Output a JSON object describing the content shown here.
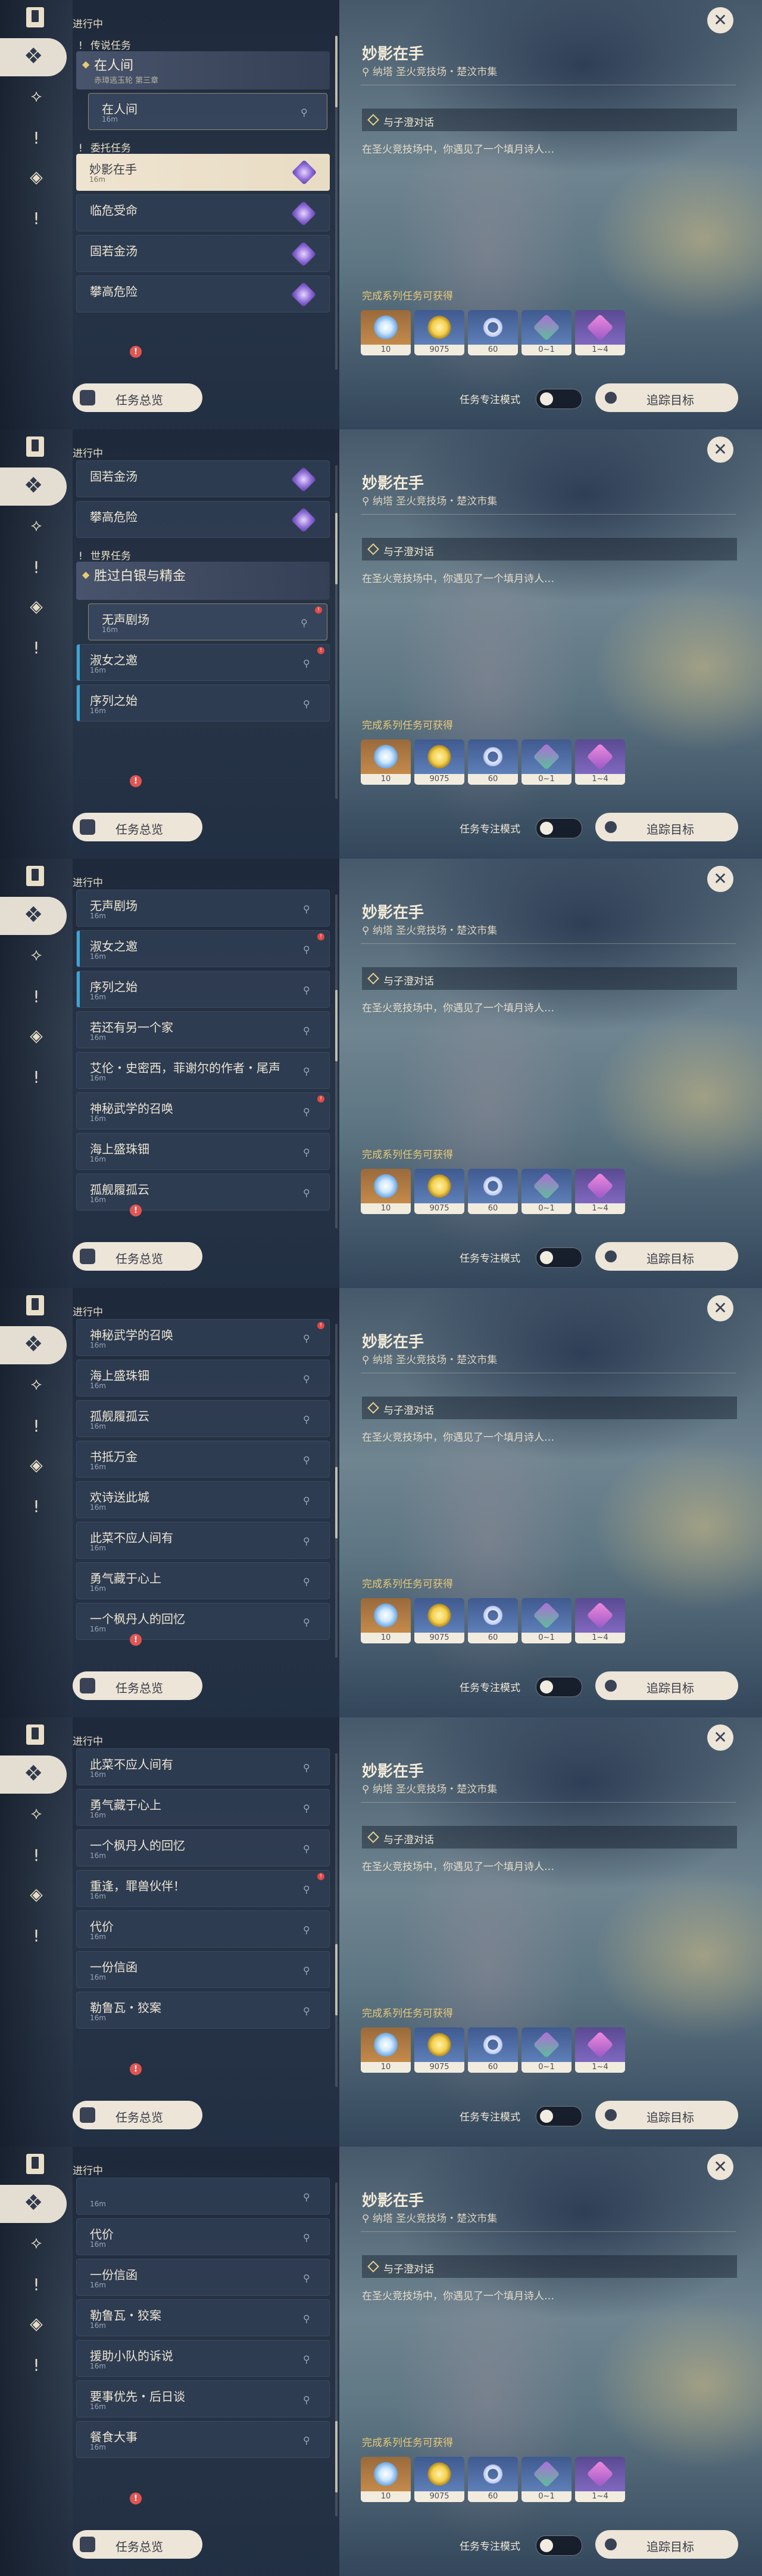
{
  "colors": {
    "accent": "#e7c978",
    "panel": "#1e2a40",
    "selected": "#efe4d0",
    "track_mark": "#3aa7d6",
    "badge": "#e05552"
  },
  "sidebar_icons": [
    "quest-book-icon",
    "diamond-icon",
    "compass-icon",
    "exclamation-icon",
    "rhombus-icon",
    "exclamation-icon"
  ],
  "common": {
    "section_title": "进行中",
    "overview_button": "任务总览",
    "track_button": "追踪目标",
    "focus_mode_label": "任务专注模式",
    "detail": {
      "title": "妙影在手",
      "location": "纳塔 圣火竞技场・楚汶市集",
      "objective": "与子澄对话",
      "description": "在圣火竞技场中，你遇见了一个填月诗人…",
      "reward_heading": "完成系列任务可获得",
      "rewards": [
        {
          "name": "exp-icon",
          "count": "10"
        },
        {
          "name": "mora-icon",
          "count": "9075"
        },
        {
          "name": "fate-icon",
          "count": "60"
        },
        {
          "name": "green-crystal-icon",
          "count": "0~1"
        },
        {
          "name": "purple-crystal-icon",
          "count": "1~4"
        }
      ]
    }
  },
  "frames": [
    {
      "items": [
        {
          "kind": "group",
          "label": "传说任务"
        },
        {
          "kind": "chapter",
          "label": "在人间",
          "sub": "赤璋逃玉轮 第三章"
        },
        {
          "kind": "child",
          "label": "在人间",
          "dist": "16m"
        },
        {
          "kind": "group",
          "label": "委托任务"
        },
        {
          "kind": "selected",
          "label": "妙影在手",
          "dist": "16m",
          "gem": true
        },
        {
          "kind": "row",
          "label": "临危受命",
          "gem": true
        },
        {
          "kind": "row",
          "label": "固若金汤",
          "gem": true
        },
        {
          "kind": "row",
          "label": "攀高危险",
          "gem": true
        }
      ]
    },
    {
      "items": [
        {
          "kind": "row",
          "label": "固若金汤",
          "gem": true
        },
        {
          "kind": "row",
          "label": "攀高危险",
          "gem": true
        },
        {
          "kind": "group",
          "label": "世界任务"
        },
        {
          "kind": "chapter",
          "label": "胜过白银与精金",
          "sub": ""
        },
        {
          "kind": "child",
          "label": "无声剧场",
          "dist": "16m",
          "badge": true
        },
        {
          "kind": "marked",
          "label": "淑女之邀",
          "dist": "16m",
          "badge": true
        },
        {
          "kind": "marked",
          "label": "序列之始",
          "dist": "16m"
        }
      ]
    },
    {
      "items": [
        {
          "kind": "row",
          "label": "无声剧场",
          "dist": "16m"
        },
        {
          "kind": "marked",
          "label": "淑女之邀",
          "dist": "16m",
          "badge": true
        },
        {
          "kind": "marked",
          "label": "序列之始",
          "dist": "16m"
        },
        {
          "kind": "row",
          "label": "若还有另一个家",
          "dist": "16m"
        },
        {
          "kind": "row",
          "label": "艾伦・史密西，菲谢尔的作者・尾声",
          "dist": "16m"
        },
        {
          "kind": "row",
          "label": "神秘武学的召唤",
          "dist": "16m",
          "badge": true
        },
        {
          "kind": "row",
          "label": "海上盛珠钿",
          "dist": "16m"
        },
        {
          "kind": "row",
          "label": "孤舰履孤云",
          "dist": "16m"
        }
      ]
    },
    {
      "items": [
        {
          "kind": "row",
          "label": "神秘武学的召唤",
          "dist": "16m",
          "badge": true
        },
        {
          "kind": "row",
          "label": "海上盛珠钿",
          "dist": "16m"
        },
        {
          "kind": "row",
          "label": "孤舰履孤云",
          "dist": "16m"
        },
        {
          "kind": "row",
          "label": "书抵万金",
          "dist": "16m"
        },
        {
          "kind": "row",
          "label": "欢诗送此城",
          "dist": "16m"
        },
        {
          "kind": "row",
          "label": "此菜不应人间有",
          "dist": "16m"
        },
        {
          "kind": "row",
          "label": "勇气藏于心上",
          "dist": "16m"
        },
        {
          "kind": "row",
          "label": "一个枫丹人的回忆",
          "dist": "16m"
        }
      ]
    },
    {
      "items": [
        {
          "kind": "row",
          "label": "此菜不应人间有",
          "dist": "16m"
        },
        {
          "kind": "row",
          "label": "勇气藏于心上",
          "dist": "16m"
        },
        {
          "kind": "row",
          "label": "一个枫丹人的回忆",
          "dist": "16m"
        },
        {
          "kind": "row",
          "label": "重逢，罪兽伙伴！",
          "dist": "16m",
          "badge": true
        },
        {
          "kind": "row",
          "label": "代价",
          "dist": "16m"
        },
        {
          "kind": "row",
          "label": "一份信函",
          "dist": "16m"
        },
        {
          "kind": "row",
          "label": "勒鲁瓦・狡案",
          "dist": "16m"
        }
      ]
    },
    {
      "items": [
        {
          "kind": "row",
          "label": "",
          "dist": "16m"
        },
        {
          "kind": "row",
          "label": "代价",
          "dist": "16m"
        },
        {
          "kind": "row",
          "label": "一份信函",
          "dist": "16m"
        },
        {
          "kind": "row",
          "label": "勒鲁瓦・狡案",
          "dist": "16m"
        },
        {
          "kind": "row",
          "label": "援助小队的诉说",
          "dist": "16m"
        },
        {
          "kind": "row",
          "label": "要事优先・后日谈",
          "dist": "16m"
        },
        {
          "kind": "row",
          "label": "餐食大事",
          "dist": "16m"
        }
      ]
    }
  ]
}
